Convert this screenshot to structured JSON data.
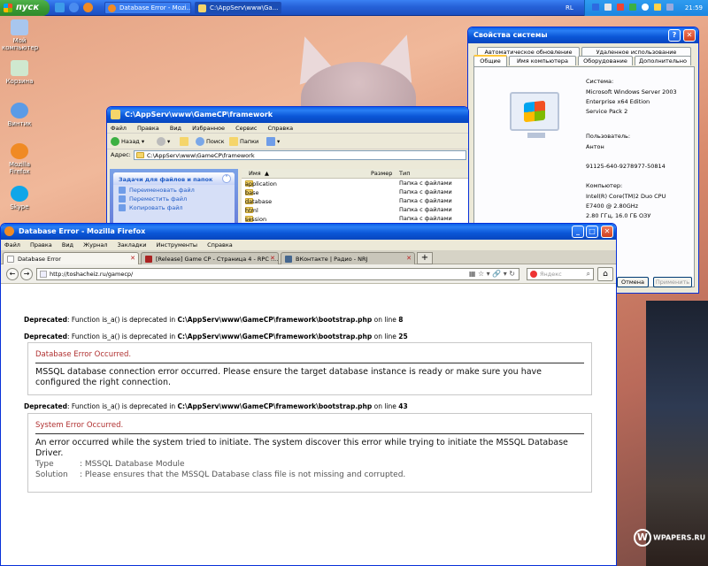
{
  "taskbar": {
    "start_label": "пуск",
    "tasks": [
      {
        "label": "Database Error - Mozi..."
      },
      {
        "label": "C:\\AppServ\\www\\Ga..."
      }
    ],
    "lang": "RL",
    "clock": "21:59"
  },
  "desktop": {
    "icons": [
      {
        "label": "Мой компьютер"
      },
      {
        "label": "Корзина"
      },
      {
        "label": "Винтик"
      },
      {
        "label": "Mozilla Firefox"
      },
      {
        "label": "Skype"
      }
    ],
    "watermark": "WPAPERS.RU"
  },
  "sysprop": {
    "title": "Свойства системы",
    "tabs_row1": [
      "Автоматическое обновление",
      "Удаленное использование"
    ],
    "tabs_row2": [
      "Общие",
      "Имя компьютера",
      "Оборудование",
      "Дополнительно"
    ],
    "system_label": "Система:",
    "os_lines": [
      "Microsoft Windows Server 2003",
      "Enterprise x64 Edition",
      "Service Pack 2"
    ],
    "user_label": "Пользователь:",
    "user_lines": [
      "Антон",
      "",
      "91125-640-9278977-50814"
    ],
    "computer_label": "Компьютер:",
    "computer_lines": [
      "Intel(R) Core(TM)2 Duo CPU",
      "E7400  @ 2.80GHz",
      "2.80 ГГц, 16.0 ГБ ОЗУ"
    ],
    "btn_cancel": "Отмена",
    "btn_apply": "Применить"
  },
  "explorer": {
    "title": "C:\\AppServ\\www\\GameCP\\framework",
    "menu": [
      "Файл",
      "Правка",
      "Вид",
      "Избранное",
      "Сервис",
      "Справка"
    ],
    "toolbar": {
      "back": "Назад",
      "search": "Поиск",
      "folders": "Папки"
    },
    "address_label": "Адрес:",
    "address": "C:\\AppServ\\www\\GameCP\\framework",
    "tasks_header": "Задачи для файлов и папок",
    "tasks": [
      "Переименовать файл",
      "Переместить файл",
      "Копировать файл"
    ],
    "columns": {
      "name": "Имя",
      "size": "Размер",
      "type": "Тип"
    },
    "files": [
      {
        "name": "application",
        "type": "Папка с файлами"
      },
      {
        "name": "base",
        "type": "Папка с файлами"
      },
      {
        "name": "database",
        "type": "Папка с файлами"
      },
      {
        "name": "html",
        "type": "Папка с файлами"
      },
      {
        "name": "session",
        "type": "Папка с файлами"
      }
    ]
  },
  "firefox": {
    "title": "Database Error - Mozilla Firefox",
    "menu": [
      "Файл",
      "Правка",
      "Вид",
      "Журнал",
      "Закладки",
      "Инструменты",
      "Справка"
    ],
    "tabs": [
      {
        "label": "Database Error"
      },
      {
        "label": "[Release] Game CP - Страница 4 - RPC :..."
      },
      {
        "label": "ВКонтакте | Радио - NRJ"
      }
    ],
    "url": "http://toshacheiz.ru/gamecp/",
    "search_placeholder": "Яндекс",
    "content": {
      "dep_label": "Deprecated",
      "dep1": {
        "text": ": Function is_a() is deprecated in ",
        "path": "C:\\AppServ\\www\\GameCP\\framework\\bootstrap.php",
        "line_text": " on line ",
        "line": "8"
      },
      "dep2": {
        "text": ": Function is_a() is deprecated in ",
        "path": "C:\\AppServ\\www\\GameCP\\framework\\bootstrap.php",
        "line_text": " on line ",
        "line": "25"
      },
      "err1": {
        "title": "Database Error Occurred.",
        "message": "MSSQL database connection error occurred. Please ensure the target database instance is ready or make sure you have configured the right connection."
      },
      "dep3": {
        "text": ": Function is_a() is deprecated in ",
        "path": "C:\\AppServ\\www\\GameCP\\framework\\bootstrap.php",
        "line_text": " on line ",
        "line": "43"
      },
      "err2": {
        "title": "System Error Occurred.",
        "message": "An error occurred while the system tried to initiate. The system discover this error while trying to initiate the MSSQL Database Driver.",
        "type_label": "Type",
        "type_value": ": MSSQL Database Module",
        "solution_label": "Solution",
        "solution_value": ": Please ensures that the MSSQL Database class file is not missing and corrupted."
      }
    }
  }
}
